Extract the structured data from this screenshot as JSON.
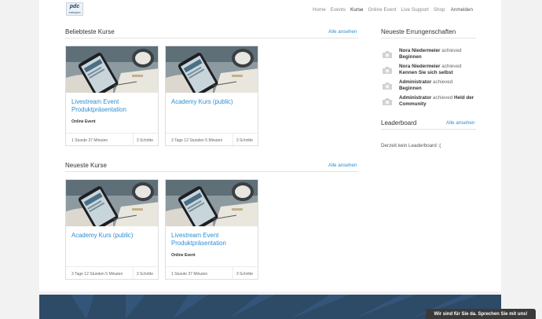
{
  "header": {
    "logo_text": "pdc",
    "logo_sub": "campus",
    "nav": [
      {
        "label": "Home"
      },
      {
        "label": "Events"
      },
      {
        "label": "Kurse"
      },
      {
        "label": "Online Event"
      },
      {
        "label": "Live Support"
      },
      {
        "label": "Shop"
      }
    ],
    "login_label": "Anmelden",
    "active_nav": "Kurse"
  },
  "popular": {
    "title": "Beliebteste Kurse",
    "see_all": "Alle ansehen",
    "cards": [
      {
        "title": "Livestream Event Produktpräsentation",
        "tag": "Online Event",
        "duration": "1 Stunde 37 Minuten",
        "steps": "3 Schritte"
      },
      {
        "title": "Academy Kurs (public)",
        "tag": "",
        "duration": "3 Tage 12 Stunden 5 Minuten",
        "steps": "3 Schritte"
      }
    ]
  },
  "newest": {
    "title": "Neueste Kurse",
    "see_all": "Alle ansehen",
    "cards": [
      {
        "title": "Academy Kurs (public)",
        "tag": "",
        "duration": "3 Tage 12 Stunden 5 Minuten",
        "steps": "3 Schritte"
      },
      {
        "title": "Livestream Event Produktpräsentation",
        "tag": "Online Event",
        "duration": "1 Stunde 37 Minuten",
        "steps": "3 Schritte"
      }
    ]
  },
  "achievements": {
    "title": "Neueste Errungenschaften",
    "items": [
      {
        "who": "Nora Niedermeier",
        "verb": "achieved",
        "what": "Beginnen"
      },
      {
        "who": "Nora Niedermeier",
        "verb": "achieved",
        "what": "Kennen Sie sich selbst"
      },
      {
        "who": "Administrator",
        "verb": "achieved",
        "what": "Beginnen"
      },
      {
        "who": "Administrator",
        "verb": "achieved",
        "what": "Held der Community"
      }
    ]
  },
  "leaderboard": {
    "title": "Leaderboard",
    "see_all": "Alle ansehen",
    "empty_text": "Derzeit kein Leaderboard :("
  },
  "chat": {
    "label": "Wir sind für Sie da. Sprechen Sie mit uns!"
  },
  "colors": {
    "accent": "#2b8fd4",
    "footer": "#2d4a66"
  }
}
